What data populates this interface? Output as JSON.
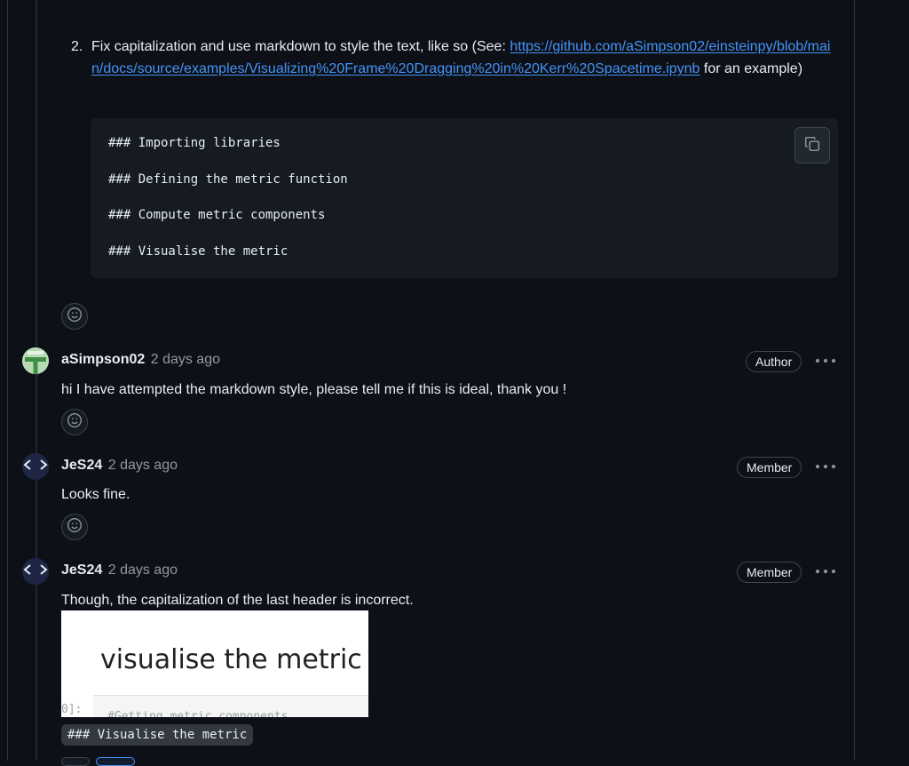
{
  "suggestion": {
    "number": "2.",
    "text_before": "Fix capitalization and use markdown to style the text, like so (See: ",
    "link": "https://github.com/aSimpson02/einsteinpy/blob/main/docs/source/examples/Visualizing%20Frame%20Dragging%20in%20Kerr%20Spacetime.ipynb",
    "text_after": " for an example)",
    "code_lines": [
      "### Importing libraries",
      "### Defining the metric function",
      "### Compute metric components",
      "### Visualise the metric"
    ],
    "copy_icon": "copy-icon"
  },
  "comments": [
    {
      "author": "aSimpson02",
      "time": "2 days ago",
      "badge": "Author",
      "body": "hi I have attempted the markdown style, please tell me if this is ideal, thank you !"
    },
    {
      "author": "JeS24",
      "time": "2 days ago",
      "badge": "Member",
      "body": "Looks fine."
    },
    {
      "author": "JeS24",
      "time": "2 days ago",
      "badge": "Member",
      "body": "Though, the capitalization of the last header is incorrect.",
      "image": {
        "title": "visualise the metric",
        "prompt": "0]:",
        "code": "#Getting metric components"
      },
      "inline_code": "### Visualise the metric"
    }
  ],
  "icons": {
    "reaction": "smiley-icon",
    "more": "kebab-icon",
    "avatar_code": "code-brackets-icon"
  },
  "colors": {
    "background": "#0d1117",
    "link": "#4493f8",
    "muted": "#9198a1",
    "border": "#3d444d"
  }
}
